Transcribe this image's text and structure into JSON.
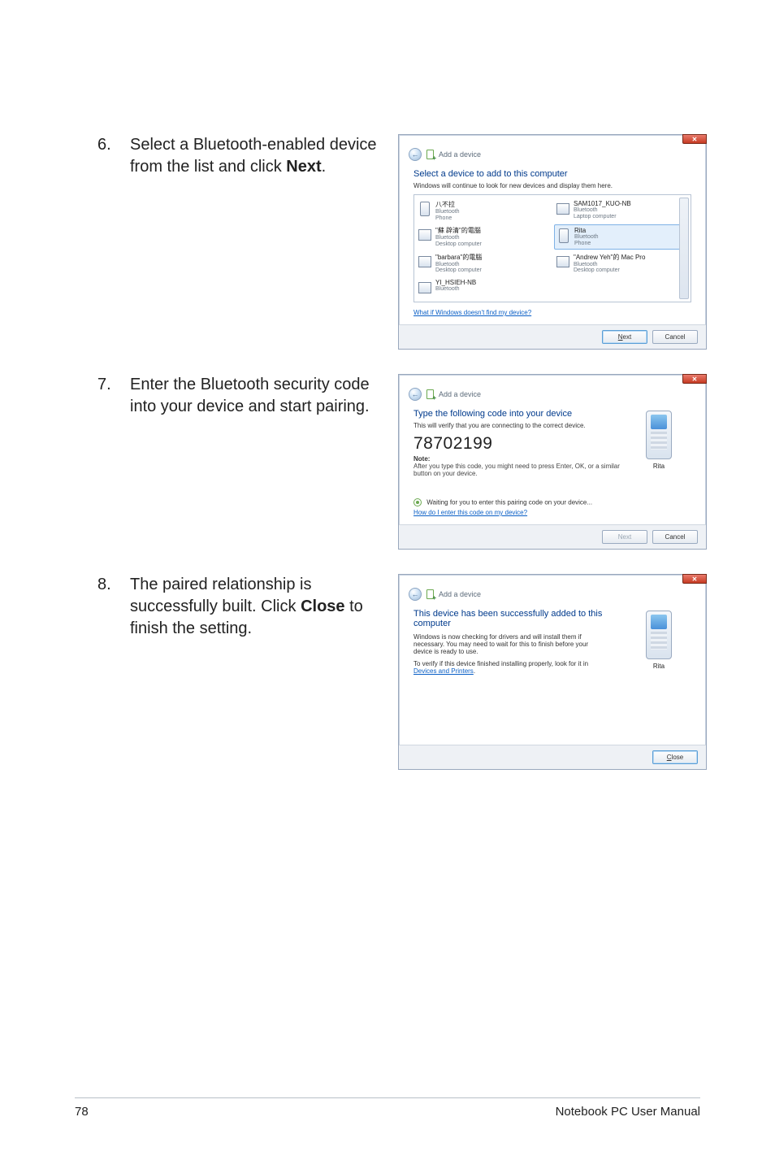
{
  "steps": {
    "s6": {
      "num": "6.",
      "text_pre": "Select a Bluetooth-enabled device from the list and click ",
      "text_bold": "Next",
      "text_post": "."
    },
    "s7": {
      "num": "7.",
      "text": "Enter the Bluetooth security code into your device and start pairing."
    },
    "s8": {
      "num": "8.",
      "text_pre": "The paired relationship is successfully built. Click ",
      "text_bold": "Close",
      "text_post": " to finish the setting."
    }
  },
  "dialog6": {
    "title": "Add a device",
    "heading": "Select a device to add to this computer",
    "subtext": "Windows will continue to look for new devices and display them here.",
    "devices": [
      {
        "name": "八不拉",
        "type": "Bluetooth",
        "kind": "Phone",
        "icon": "phone"
      },
      {
        "name": "SAM1017_KUO-NB",
        "type": "Bluetooth",
        "kind": "Laptop computer",
        "icon": "pc"
      },
      {
        "name": "\"蘇 辟清\"的電腦",
        "type": "Bluetooth",
        "kind": "Desktop computer",
        "icon": "pc"
      },
      {
        "name": "Rita",
        "type": "Bluetooth",
        "kind": "Phone",
        "icon": "phone",
        "selected": true
      },
      {
        "name": "\"barbara\"的電腦",
        "type": "Bluetooth",
        "kind": "Desktop computer",
        "icon": "pc"
      },
      {
        "name": "\"Andrew Yeh\"的 Mac Pro",
        "type": "Bluetooth",
        "kind": "Desktop computer",
        "icon": "pc"
      },
      {
        "name": "YI_HSIEH-NB",
        "type": "Bluetooth",
        "kind": "",
        "icon": "pc"
      }
    ],
    "help_link": "What if Windows doesn't find my device?",
    "next_btn": "Next",
    "cancel_btn": "Cancel"
  },
  "dialog7": {
    "title": "Add a device",
    "heading": "Type the following code into your device",
    "subtext": "This will verify that you are connecting to the correct device.",
    "code": "78702199",
    "note_label": "Note:",
    "note_body": "After you type this code, you might need to press Enter, OK, or a similar button on your device.",
    "status": "Waiting for you to enter this pairing code on your device...",
    "help_link": "How do I enter this code on my device?",
    "thumb_label": "Rita",
    "next_btn": "Next",
    "cancel_btn": "Cancel"
  },
  "dialog8": {
    "title": "Add a device",
    "heading": "This device has been successfully added to this computer",
    "subtext": "Windows is now checking for drivers and will install them if necessary. You may need to wait for this to finish before your device is ready to use.",
    "verify_pre": "To verify if this device finished installing properly, look for it in ",
    "verify_link": "Devices and Printers",
    "verify_post": ".",
    "thumb_label": "Rita",
    "close_btn": "Close"
  },
  "footer": {
    "page": "78",
    "text": "Notebook PC User Manual"
  }
}
